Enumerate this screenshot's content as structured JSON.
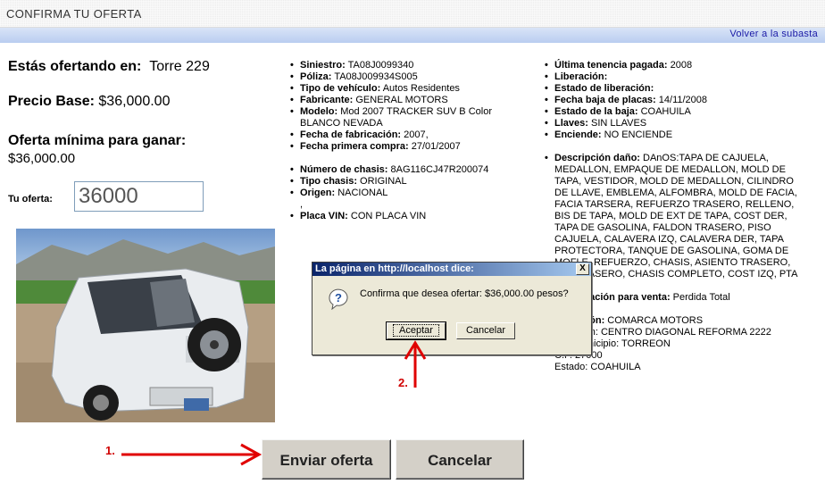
{
  "header": {
    "title": "CONFIRMA TU OFERTA",
    "back_link": "Volver a la subasta"
  },
  "offer": {
    "ofertando_label": "Estás ofertando en:",
    "ofertando_value": "Torre 229",
    "precio_base_label": "Precio Base:",
    "precio_base_value": "$36,000.00",
    "oferta_minima_label": "Oferta mínima para ganar:",
    "oferta_minima_value": "$36,000.00",
    "tu_oferta_label": "Tu oferta:",
    "tu_oferta_value": "36000"
  },
  "details_col1": [
    {
      "k": "Siniestro:",
      "v": "TA08J0099340"
    },
    {
      "k": "Póliza:",
      "v": "TA08J009934S005"
    },
    {
      "k": "Tipo de vehículo:",
      "v": "Autos Residentes"
    },
    {
      "k": "Fabricante:",
      "v": "GENERAL MOTORS"
    },
    {
      "k": "Modelo:",
      "v": "Mod 2007 TRACKER SUV B Color BLANCO NEVADA"
    },
    {
      "k": "Fecha de fabricación:",
      "v": "2007,"
    },
    {
      "k": "Fecha primera compra:",
      "v": "27/01/2007"
    },
    {
      "k": "Número de chasis:",
      "v": "8AG116CJ47R200074"
    },
    {
      "k": "Tipo chasis:",
      "v": "ORIGINAL"
    },
    {
      "k": "Origen:",
      "v": "NACIONAL"
    },
    {
      "k": "Placa VIN:",
      "v": "CON PLACA VIN"
    },
    {
      "comma": ","
    }
  ],
  "details_col2": [
    {
      "k": "Última tenencia pagada:",
      "v": "2008"
    },
    {
      "k": "Liberación:",
      "v": ""
    },
    {
      "k": "Estado de liberación:",
      "v": ""
    },
    {
      "k": "Fecha baja de placas:",
      "v": "14/11/2008"
    },
    {
      "k": "Estado de la baja:",
      "v": "COAHUILA"
    },
    {
      "k": "Llaves:",
      "v": "SIN LLAVES"
    },
    {
      "k": "Enciende:",
      "v": "NO ENCIENDE"
    },
    {
      "k": "Descripción daño:",
      "v": "DAnOS:TAPA DE CAJUELA, MEDALLON, EMPAQUE DE MEDALLON, MOLD DE TAPA, VESTIDOR, MOLD DE MEDALLON, CILINDRO DE LLAVE, EMBLEMA, ALFOMBRA, MOLD DE FACIA, FACIA TARSERA, REFUERZO TRASERO, RELLENO, BIS DE TAPA, MOLD DE EXT DE TAPA, COST DER, TAPA DE GASOLINA, FALDON TRASERO, PISO CAJUELA, CALAVERA IZQ, CALAVERA DER, TAPA PROTECTORA, TANQUE DE GASOLINA, GOMA DE MOFLE, REFUERZO, CHASIS, ASIENTO TRASERO, EJE TRASERO, CHASIS COMPLETO, COST IZQ, PTA"
    },
    {
      "k": "Clasificación para venta:",
      "v": "Perdida Total"
    },
    {
      "k": "Ubicación:",
      "v": "COMARCA MOTORS",
      "lines": [
        "Dirección: CENTRO DIAGONAL REFORMA 2222",
        "Del./Municipio: TORREON",
        "C.P. 27000",
        "Estado: COAHUILA"
      ]
    }
  ],
  "dialog": {
    "title": "La página en http://localhost dice:",
    "message": "Confirma que desea ofertar: $36,000.00 pesos?",
    "accept": "Aceptar",
    "cancel": "Cancelar",
    "close": "X"
  },
  "buttons": {
    "send": "Enviar oferta",
    "cancel": "Cancelar"
  },
  "annotations": {
    "step1": "1.",
    "step2": "2."
  },
  "colors": {
    "arrow": "#e00000",
    "nav_link": "#1a1aa6",
    "dialog_title": "#0a246a"
  },
  "icons": {
    "dialog": "question-icon",
    "photo": "vehicle-photo"
  }
}
